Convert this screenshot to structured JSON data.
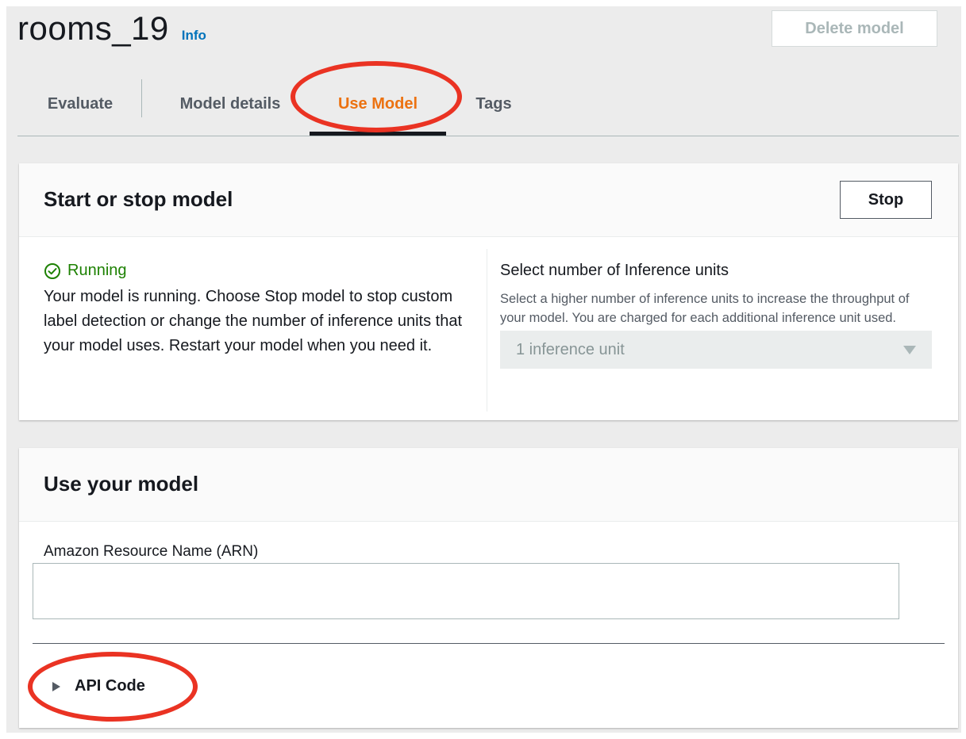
{
  "header": {
    "title": "rooms_19",
    "info_label": "Info",
    "delete_label": "Delete model"
  },
  "tabs": [
    {
      "label": "Evaluate",
      "active": false
    },
    {
      "label": "Model details",
      "active": false
    },
    {
      "label": "Use Model",
      "active": true
    },
    {
      "label": "Tags",
      "active": false
    }
  ],
  "start_stop": {
    "title": "Start or stop model",
    "stop_label": "Stop",
    "status": "Running",
    "description": "Your model is running. Choose Stop model to stop custom label detection or change the number of inference units that your model uses. Restart your model when you need it.",
    "inference_label": "Select number of Inference units",
    "inference_description": "Select a higher number of inference units to increase the throughput of your model. You are charged for each additional inference unit used.",
    "inference_value": "1 inference unit"
  },
  "use_model": {
    "title": "Use your model",
    "arn_label": "Amazon Resource Name (ARN)",
    "arn_value": "",
    "api_code_label": "API Code"
  },
  "colors": {
    "accent": "#ec7211",
    "link": "#0073bb",
    "success": "#1d8102",
    "annotation": "#ea3323"
  },
  "icons": {
    "status": "check-circle-icon",
    "select": "caret-down-icon",
    "expand": "caret-right-icon"
  }
}
